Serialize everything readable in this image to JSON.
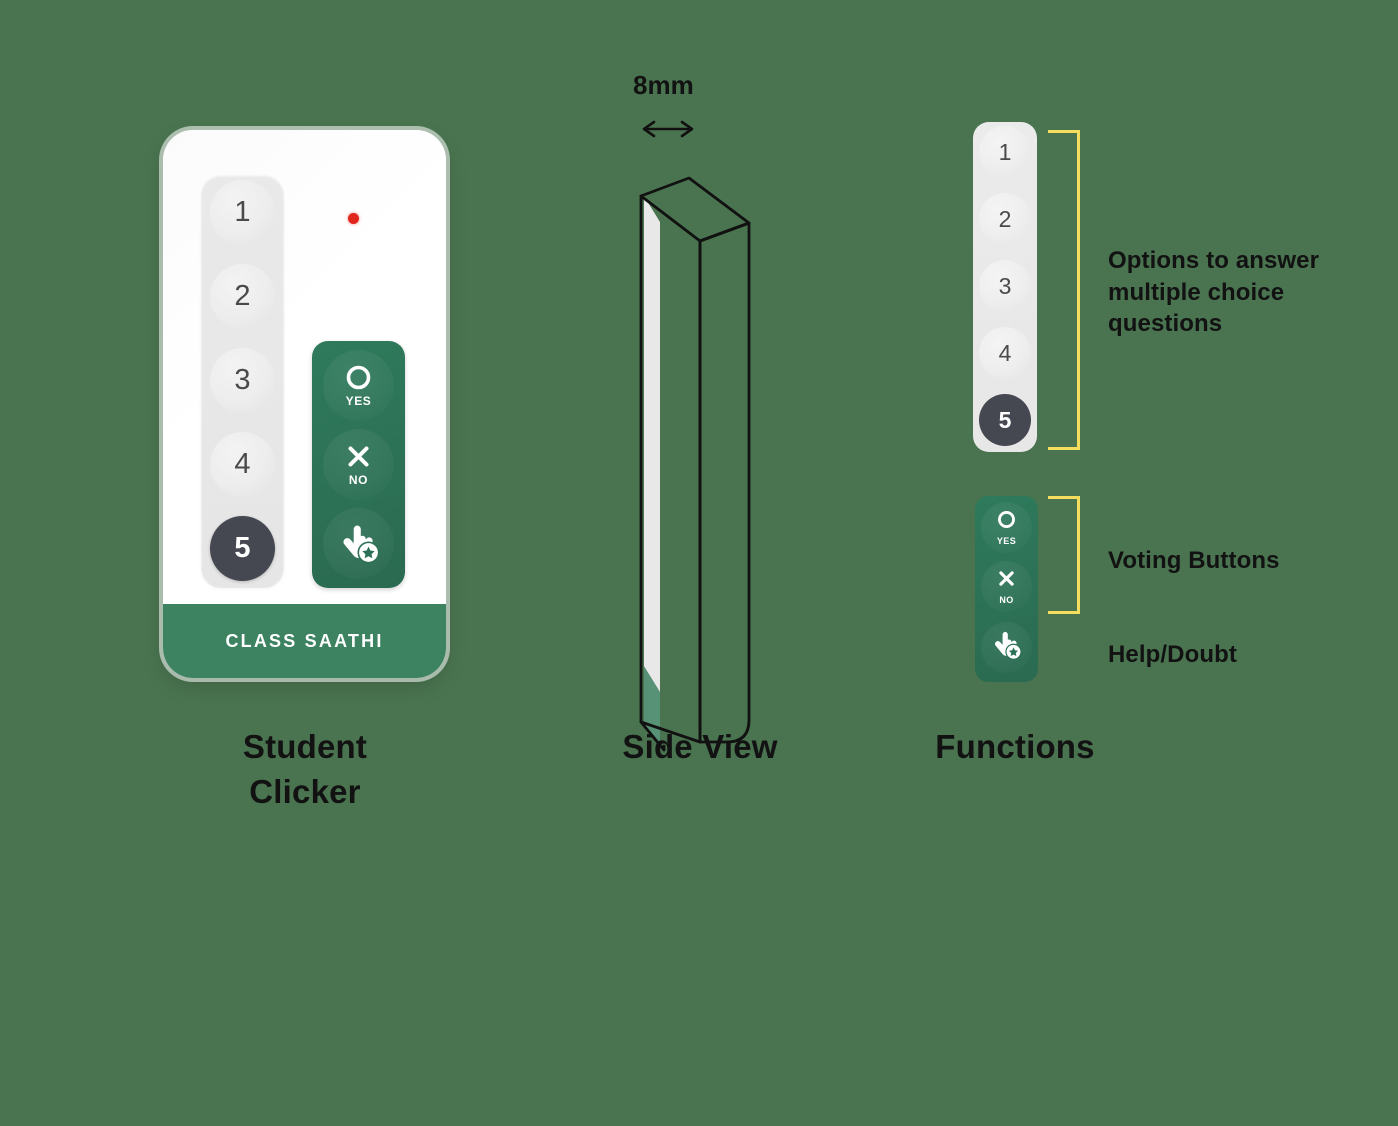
{
  "background_color": "#4a7450",
  "accent_green": "#2c7156",
  "band_green": "#3d8361",
  "bracket_yellow": "#f5dd5d",
  "selected_dark": "#454751",
  "led_red": "#e0261c",
  "clicker": {
    "brand": "CLASS SAATHI",
    "caption_line1": "Student",
    "caption_line2": "Clicker",
    "number_buttons": [
      {
        "label": "1",
        "selected": false
      },
      {
        "label": "2",
        "selected": false
      },
      {
        "label": "3",
        "selected": false
      },
      {
        "label": "4",
        "selected": false
      },
      {
        "label": "5",
        "selected": true
      }
    ],
    "green_buttons": [
      {
        "icon": "circle-outline-icon",
        "label": "YES"
      },
      {
        "icon": "cross-icon",
        "label": "NO"
      },
      {
        "icon": "hand-pointer-star-icon",
        "label": ""
      }
    ],
    "led": {
      "name": "status-led",
      "color": "#e0261c"
    }
  },
  "side_view": {
    "caption": "Side View",
    "dimension_label": "8mm"
  },
  "functions": {
    "caption": "Functions",
    "number_buttons": [
      {
        "label": "1",
        "selected": false
      },
      {
        "label": "2",
        "selected": false
      },
      {
        "label": "3",
        "selected": false
      },
      {
        "label": "4",
        "selected": false
      },
      {
        "label": "5",
        "selected": true
      }
    ],
    "green_buttons": [
      {
        "icon": "circle-outline-icon",
        "label": "YES"
      },
      {
        "icon": "cross-icon",
        "label": "NO"
      },
      {
        "icon": "hand-pointer-star-icon",
        "label": ""
      }
    ],
    "annotations": {
      "options_line1": "Options to answer",
      "options_line2": "multiple choice",
      "options_line3": "questions",
      "voting": "Voting Buttons",
      "help": "Help/Doubt"
    }
  }
}
